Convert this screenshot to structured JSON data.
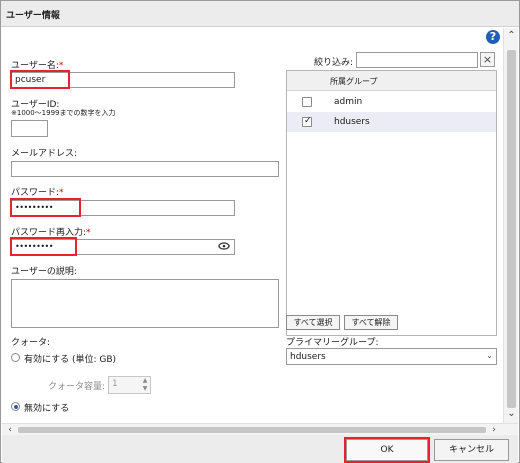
{
  "dialog": {
    "title": "ユーザー情報",
    "help_icon": "?"
  },
  "form": {
    "username": {
      "label": "ユーザー名:",
      "required_mark": "*",
      "value": "pcuser"
    },
    "userid": {
      "label": "ユーザーID:",
      "hint": "※1000～1999までの数字を入力",
      "value": ""
    },
    "email": {
      "label": "メールアドレス:",
      "value": ""
    },
    "password": {
      "label": "パスワード:",
      "required_mark": "*",
      "value": "•••••••••"
    },
    "password_confirm": {
      "label": "パスワード再入力:",
      "required_mark": "*",
      "value": "•••••••••"
    },
    "description": {
      "label": "ユーザーの説明:",
      "value": ""
    },
    "quota": {
      "label": "クォータ:",
      "enable_label": "有効にする (単位: GB)",
      "capacity_label": "クォータ容量:",
      "capacity_value": "1",
      "disable_label": "無効にする",
      "selected": "disable"
    }
  },
  "groups": {
    "filter_label": "絞り込み:",
    "filter_value": "",
    "filter_clear_icon": "×",
    "column_header": "所属グループ",
    "items": [
      {
        "name": "admin",
        "checked": false
      },
      {
        "name": "hdusers",
        "checked": true
      }
    ],
    "select_all_label": "すべて選択",
    "deselect_all_label": "すべて解除",
    "primary_label": "プライマリーグループ:",
    "primary_value": "hdusers"
  },
  "buttons": {
    "ok": "OK",
    "cancel": "キャンセル"
  }
}
